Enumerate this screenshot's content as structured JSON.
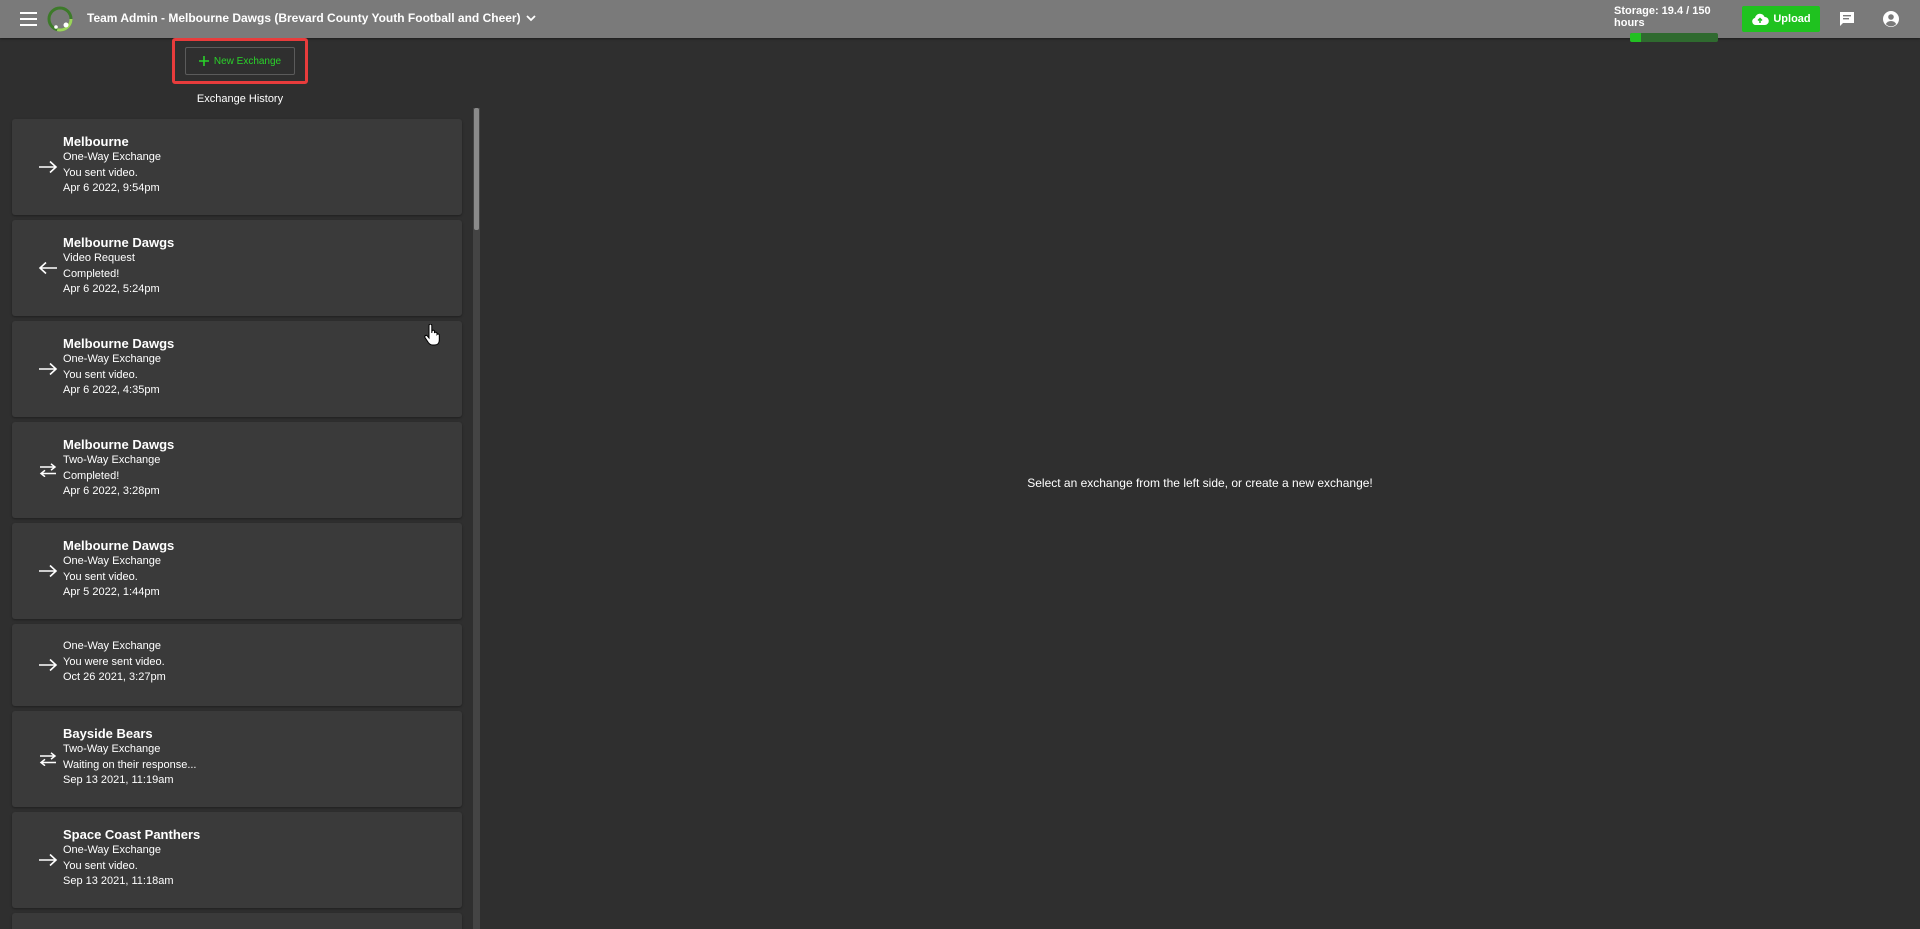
{
  "header": {
    "team_title": "Team Admin - Melbourne Dawgs (Brevard County Youth Football and Cheer)",
    "storage_label": "Storage: 19.4 / 150 hours",
    "storage_used_fraction": 0.129,
    "upload_label": "Upload",
    "icons": [
      "menu-icon",
      "logo",
      "chevron-down-icon",
      "cloud-upload-icon",
      "chat-icon",
      "account-circle-icon"
    ]
  },
  "colors": {
    "topbar": "#7a7a7a",
    "background": "#2f2f2f",
    "card": "#3a3a3a",
    "accent_green": "#1fc21f",
    "highlight_red": "#e83c3c"
  },
  "toolbar": {
    "new_exchange_label": "New Exchange"
  },
  "sidebar": {
    "title": "Exchange History",
    "items": [
      {
        "name": "Melbourne",
        "type": "One-Way Exchange",
        "status": "You sent video.",
        "date": "Apr 6 2022, 9:54pm",
        "direction": "outgoing"
      },
      {
        "name": "Melbourne Dawgs",
        "type": "Video Request",
        "status": "Completed!",
        "date": "Apr 6 2022, 5:24pm",
        "direction": "incoming"
      },
      {
        "name": "Melbourne Dawgs",
        "type": "One-Way Exchange",
        "status": "You sent video.",
        "date": "Apr 6 2022, 4:35pm",
        "direction": "outgoing"
      },
      {
        "name": "Melbourne Dawgs",
        "type": "Two-Way Exchange",
        "status": "Completed!",
        "date": "Apr 6 2022, 3:28pm",
        "direction": "two-way"
      },
      {
        "name": "Melbourne Dawgs",
        "type": "One-Way Exchange",
        "status": "You sent video.",
        "date": "Apr 5 2022, 1:44pm",
        "direction": "outgoing"
      },
      {
        "name": "",
        "type": "One-Way Exchange",
        "status": "You were sent video.",
        "date": "Oct 26 2021, 3:27pm",
        "direction": "outgoing"
      },
      {
        "name": "Bayside Bears",
        "type": "Two-Way Exchange",
        "status": "Waiting on their response...",
        "date": "Sep 13 2021, 11:19am",
        "direction": "two-way"
      },
      {
        "name": "Space Coast Panthers",
        "type": "One-Way Exchange",
        "status": "You sent video.",
        "date": "Sep 13 2021, 11:18am",
        "direction": "outgoing"
      }
    ]
  },
  "main": {
    "placeholder": "Select an exchange from the left side, or create a new exchange!"
  }
}
